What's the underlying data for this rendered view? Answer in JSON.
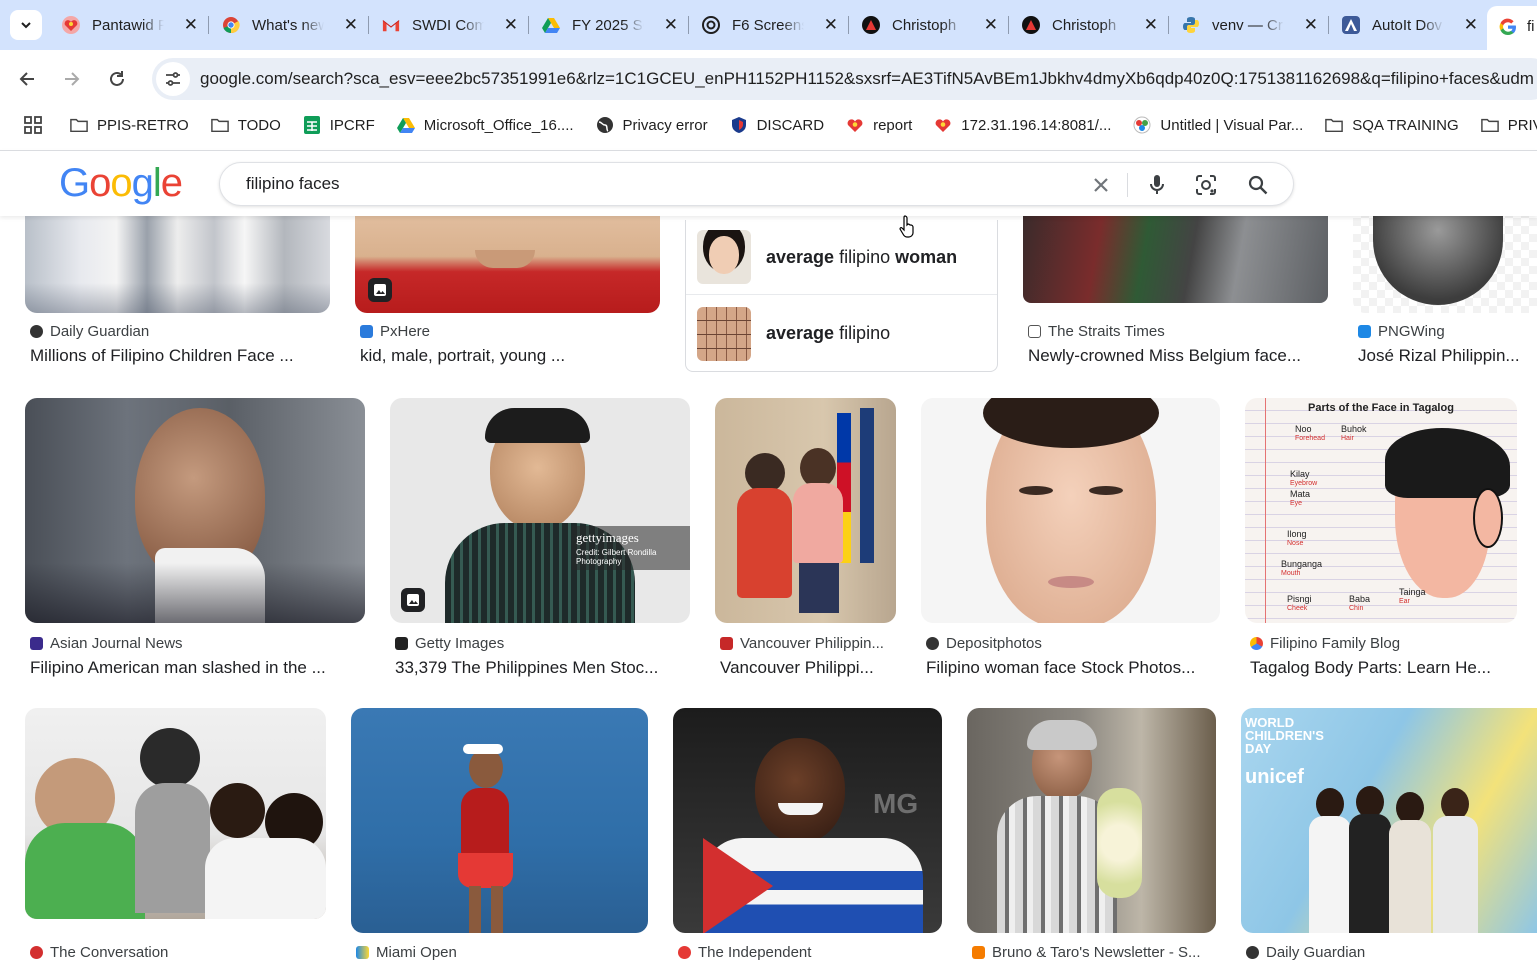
{
  "browser": {
    "tabs": [
      {
        "title": "Pantawid P",
        "icon": "heart-logo-icon"
      },
      {
        "title": "What's new",
        "icon": "chrome-icon"
      },
      {
        "title": "SWDI Com",
        "icon": "gmail-icon"
      },
      {
        "title": "FY 2025 SC",
        "icon": "google-drive-icon"
      },
      {
        "title": "F6 Screens",
        "icon": "openai-icon"
      },
      {
        "title": "Christoph",
        "icon": "christoph-icon"
      },
      {
        "title": "Christoph",
        "icon": "christoph-icon"
      },
      {
        "title": "venv — Cr",
        "icon": "python-icon"
      },
      {
        "title": "AutoIt Dov",
        "icon": "autoit-icon"
      },
      {
        "title": "fi",
        "icon": "google-icon"
      }
    ],
    "url": "google.com/search?sca_esv=eee2bc57351991e6&rlz=1C1GCEU_enPH1152PH1152&sxsrf=AE3TifN5AvBEm1Jbkhv4dmyXb6qdp40z0Q:1751381162698&q=filipino+faces&udm",
    "bookmarks": [
      {
        "label": "PPIS-RETRO",
        "icon": "folder-icon"
      },
      {
        "label": "TODO",
        "icon": "folder-icon"
      },
      {
        "label": "IPCRF",
        "icon": "sheets-icon"
      },
      {
        "label": "Microsoft_Office_16....",
        "icon": "drive-icon"
      },
      {
        "label": "Privacy error",
        "icon": "globe-icon"
      },
      {
        "label": "DISCARD",
        "icon": "shield-icon"
      },
      {
        "label": "report",
        "icon": "heart-logo-icon"
      },
      {
        "label": "172.31.196.14:8081/...",
        "icon": "heart-logo-icon"
      },
      {
        "label": "Untitled | Visual Par...",
        "icon": "visual-paradigm-icon"
      },
      {
        "label": "SQA TRAINING",
        "icon": "folder-icon"
      },
      {
        "label": "PRIVATE",
        "icon": "folder-icon"
      }
    ]
  },
  "google": {
    "logo": [
      "G",
      "o",
      "o",
      "g",
      "l",
      "e"
    ],
    "query": "filipino faces"
  },
  "suggestions": [
    {
      "bold1": "average",
      "plain": " filipino ",
      "bold2": "woman"
    },
    {
      "bold1": "average",
      "plain": " filipino",
      "bold2": ""
    }
  ],
  "row1": [
    {
      "source": "Daily Guardian",
      "title": "Millions of Filipino Children Face ..."
    },
    {
      "source": "PxHere",
      "title": "kid, male, portrait, young ..."
    },
    {
      "source": "The Straits Times",
      "title": "Newly-crowned Miss Belgium face..."
    },
    {
      "source": "PNGWing",
      "title": "José Rizal Philippin..."
    }
  ],
  "row2": [
    {
      "source": "Asian Journal News",
      "title": "Filipino American man slashed in the ..."
    },
    {
      "source": "Getty Images",
      "title": "33,379 The Philippines Men Stoc...",
      "watermark": "gettyimages",
      "credit": "Credit: Gilbert Rondilla Photography"
    },
    {
      "source": "Vancouver Philippin...",
      "title": "Vancouver Philippi..."
    },
    {
      "source": "Depositphotos",
      "title": "Filipino woman face Stock Photos..."
    },
    {
      "source": "Filipino Family Blog",
      "title": "Tagalog Body Parts: Learn He..."
    }
  ],
  "diagram": {
    "heading": "Parts of the Face in Tagalog",
    "labels": [
      {
        "tl": "Noo",
        "en": "Forehead"
      },
      {
        "tl": "Buhok",
        "en": "Hair"
      },
      {
        "tl": "Kilay",
        "en": "Eyebrow"
      },
      {
        "tl": "Mata",
        "en": "Eye"
      },
      {
        "tl": "Ilong",
        "en": "Nose"
      },
      {
        "tl": "Bunganga",
        "en": "Mouth"
      },
      {
        "tl": "Pisngi",
        "en": "Cheek"
      },
      {
        "tl": "Baba",
        "en": "Chin"
      },
      {
        "tl": "Tainga",
        "en": "Ear"
      }
    ]
  },
  "row3": [
    {
      "source": "The Conversation"
    },
    {
      "source": "Miami Open"
    },
    {
      "source": "The Independent",
      "overlay": "MG"
    },
    {
      "source": "Bruno & Taro's Newsletter - S..."
    },
    {
      "source": "Daily Guardian",
      "overlay_lines": [
        "WORLD",
        "CHILDREN'S",
        "DAY"
      ],
      "brand": "unicef"
    }
  ],
  "colors": {
    "tabstrip": "#d3e3fd",
    "omnibox": "#e9eef6",
    "google_blue": "#4285f4",
    "google_red": "#ea4335",
    "google_yellow": "#fbbc05",
    "google_green": "#34a853"
  }
}
